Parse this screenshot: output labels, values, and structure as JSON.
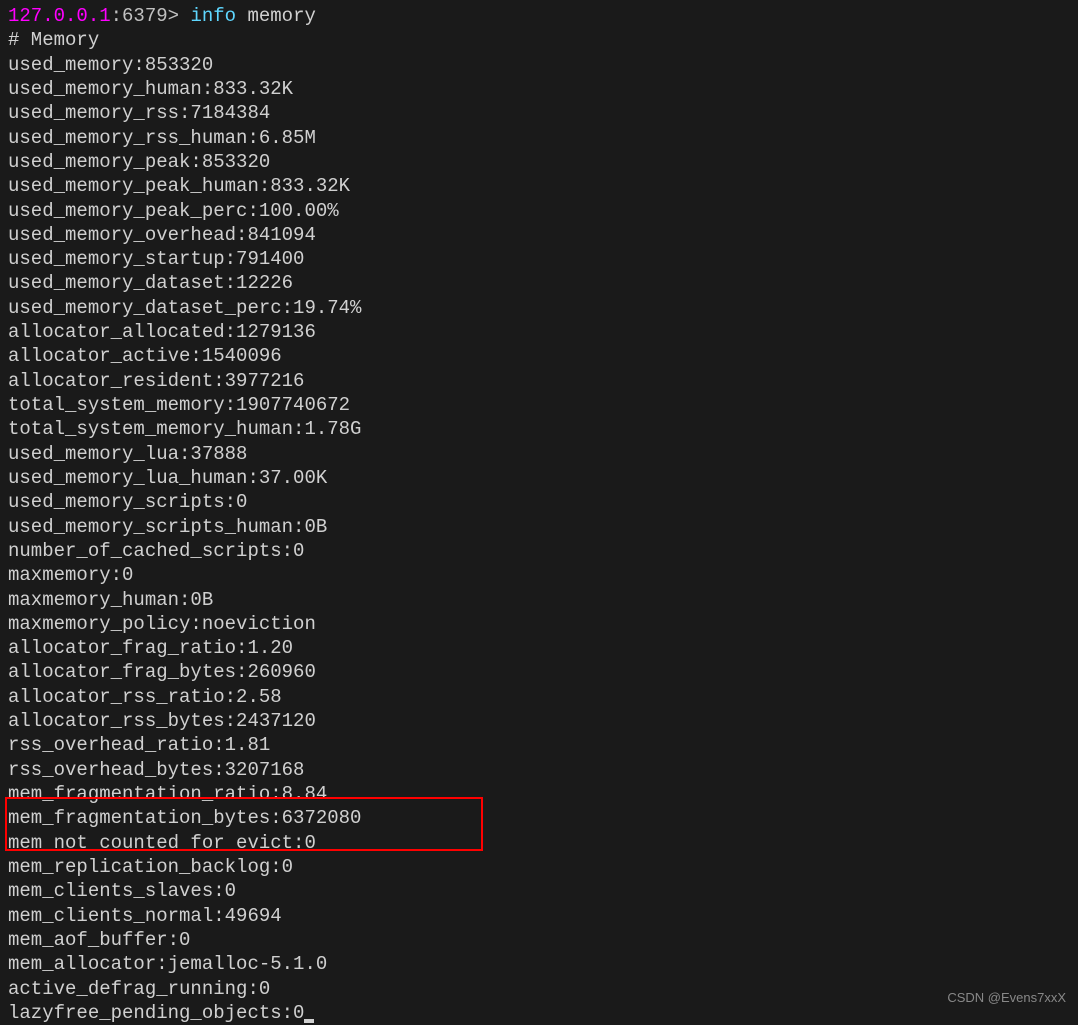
{
  "prompt": {
    "host": "127.0.0.1",
    "port": ":6379",
    "arrow": "> ",
    "command": "info",
    "arg": " memory"
  },
  "output": {
    "header": "# Memory",
    "lines": [
      "used_memory:853320",
      "used_memory_human:833.32K",
      "used_memory_rss:7184384",
      "used_memory_rss_human:6.85M",
      "used_memory_peak:853320",
      "used_memory_peak_human:833.32K",
      "used_memory_peak_perc:100.00%",
      "used_memory_overhead:841094",
      "used_memory_startup:791400",
      "used_memory_dataset:12226",
      "used_memory_dataset_perc:19.74%",
      "allocator_allocated:1279136",
      "allocator_active:1540096",
      "allocator_resident:3977216",
      "total_system_memory:1907740672",
      "total_system_memory_human:1.78G",
      "used_memory_lua:37888",
      "used_memory_lua_human:37.00K",
      "used_memory_scripts:0",
      "used_memory_scripts_human:0B",
      "number_of_cached_scripts:0",
      "maxmemory:0",
      "maxmemory_human:0B",
      "maxmemory_policy:noeviction",
      "allocator_frag_ratio:1.20",
      "allocator_frag_bytes:260960",
      "allocator_rss_ratio:2.58",
      "allocator_rss_bytes:2437120",
      "rss_overhead_ratio:1.81",
      "rss_overhead_bytes:3207168",
      "mem_fragmentation_ratio:8.84",
      "mem_fragmentation_bytes:6372080",
      "mem_not_counted_for_evict:0",
      "mem_replication_backlog:0",
      "mem_clients_slaves:0",
      "mem_clients_normal:49694",
      "mem_aof_buffer:0",
      "mem_allocator:jemalloc-5.1.0",
      "active_defrag_running:0",
      "lazyfree_pending_objects:0"
    ]
  },
  "watermark": "CSDN @Evens7xxX"
}
